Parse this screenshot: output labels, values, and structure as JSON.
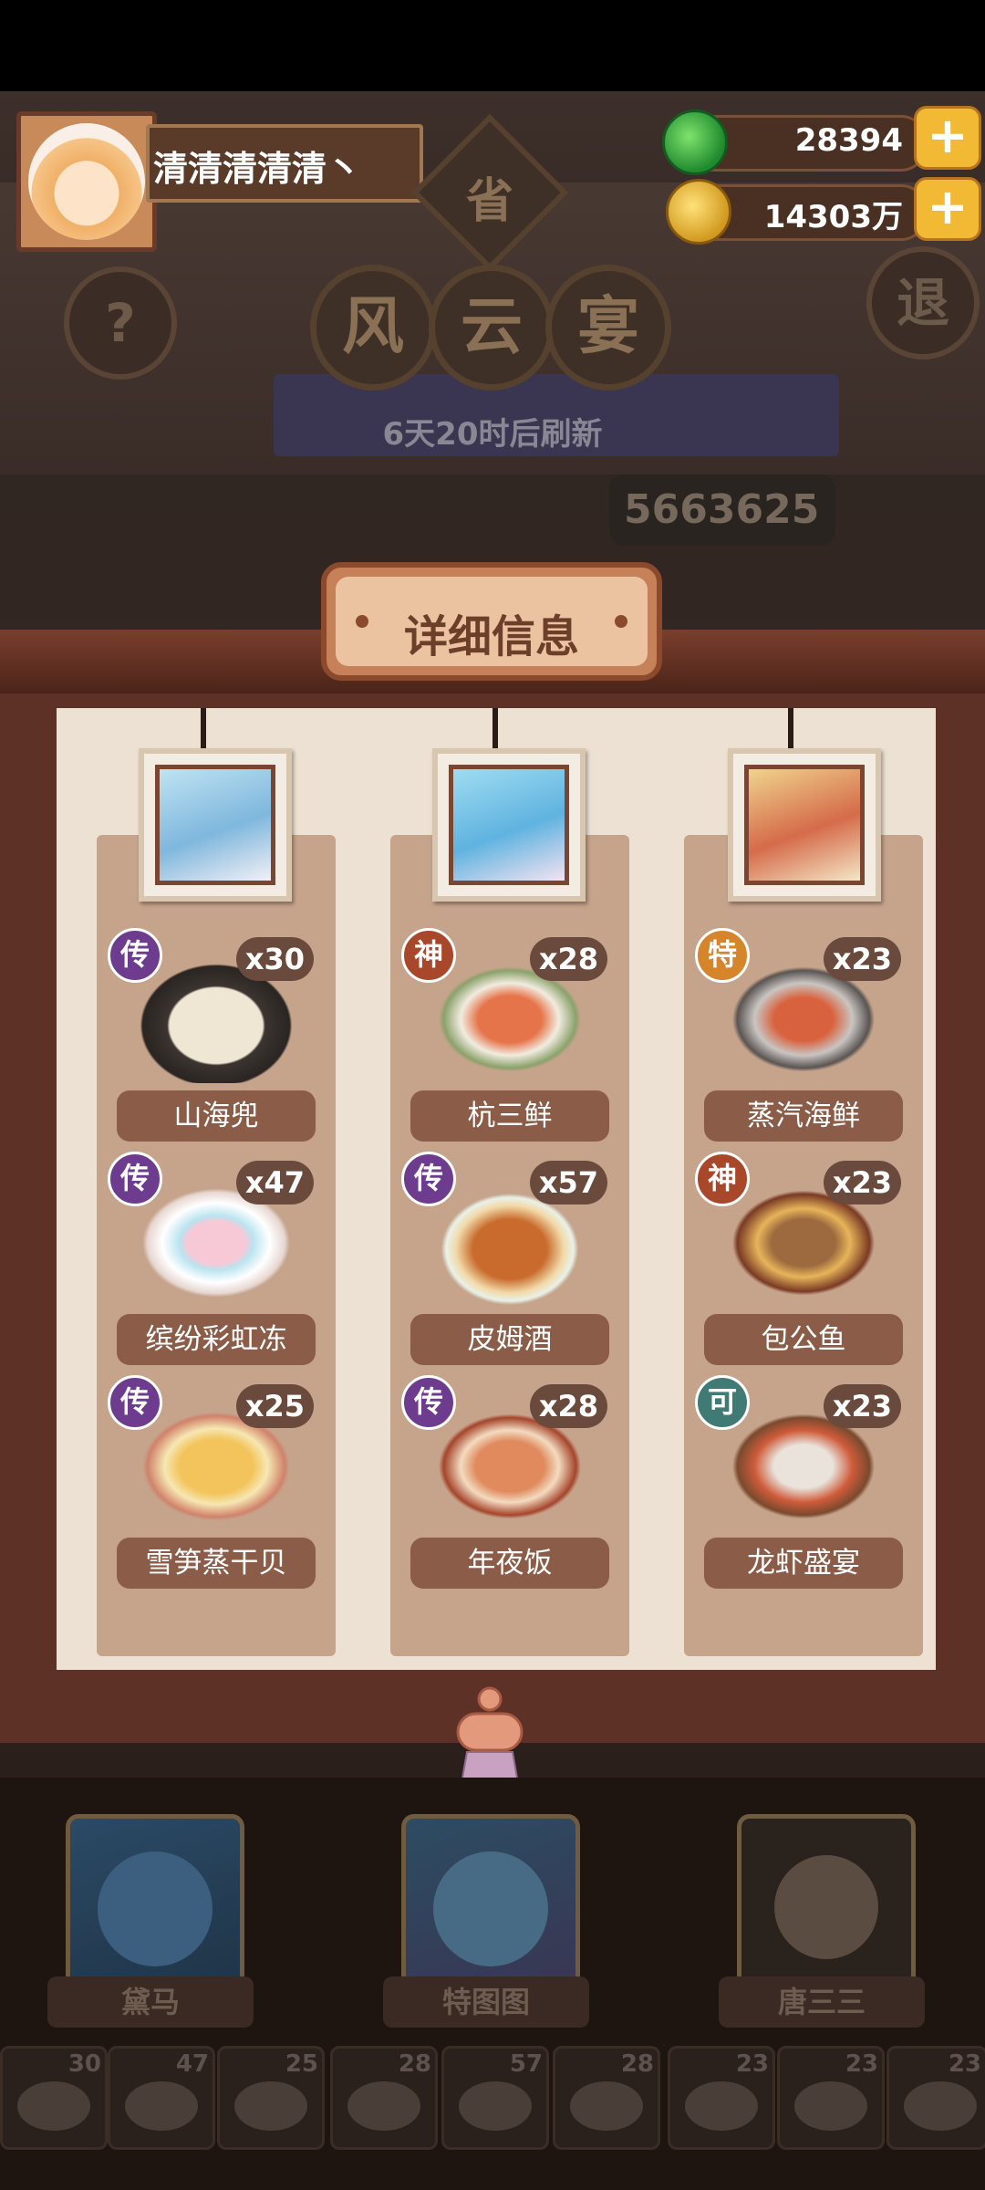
{
  "player": {
    "name": "清清清清清丶"
  },
  "resources": [
    {
      "icon": "jade-icon",
      "value": "28394"
    },
    {
      "icon": "coin-icon",
      "value": "14303万"
    }
  ],
  "header": {
    "province_label": "省",
    "title_chars": [
      "风",
      "云",
      "宴"
    ],
    "help_label": "?",
    "exit_label": "退",
    "refresh_text": "6天20时后刷新",
    "score": "5663625"
  },
  "detail": {
    "title": "详细信息",
    "columns": [
      {
        "dishes": [
          {
            "name": "山海兜",
            "grade": "传",
            "qty": "x30"
          },
          {
            "name": "缤纷彩虹冻",
            "grade": "传",
            "qty": "x47"
          },
          {
            "name": "雪笋蒸干贝",
            "grade": "传",
            "qty": "x25"
          }
        ]
      },
      {
        "dishes": [
          {
            "name": "杭三鲜",
            "grade": "神",
            "qty": "x28"
          },
          {
            "name": "皮姆酒",
            "grade": "传",
            "qty": "x57"
          },
          {
            "name": "年夜饭",
            "grade": "传",
            "qty": "x28"
          }
        ]
      },
      {
        "dishes": [
          {
            "name": "蒸汽海鲜",
            "grade": "特",
            "qty": "x23"
          },
          {
            "name": "包公鱼",
            "grade": "神",
            "qty": "x23"
          },
          {
            "name": "龙虾盛宴",
            "grade": "可",
            "qty": "x23"
          }
        ]
      }
    ]
  },
  "grade_colors": {
    "传": "#6d3c8f",
    "神": "#a9472a",
    "特": "#d6852a",
    "可": "#3f7a74"
  },
  "characters": [
    {
      "name": "黛马"
    },
    {
      "name": "特图图"
    },
    {
      "name": "唐三三"
    }
  ],
  "dish_bar": [
    "30",
    "47",
    "25",
    "28",
    "57",
    "28",
    "23",
    "23",
    "23"
  ]
}
